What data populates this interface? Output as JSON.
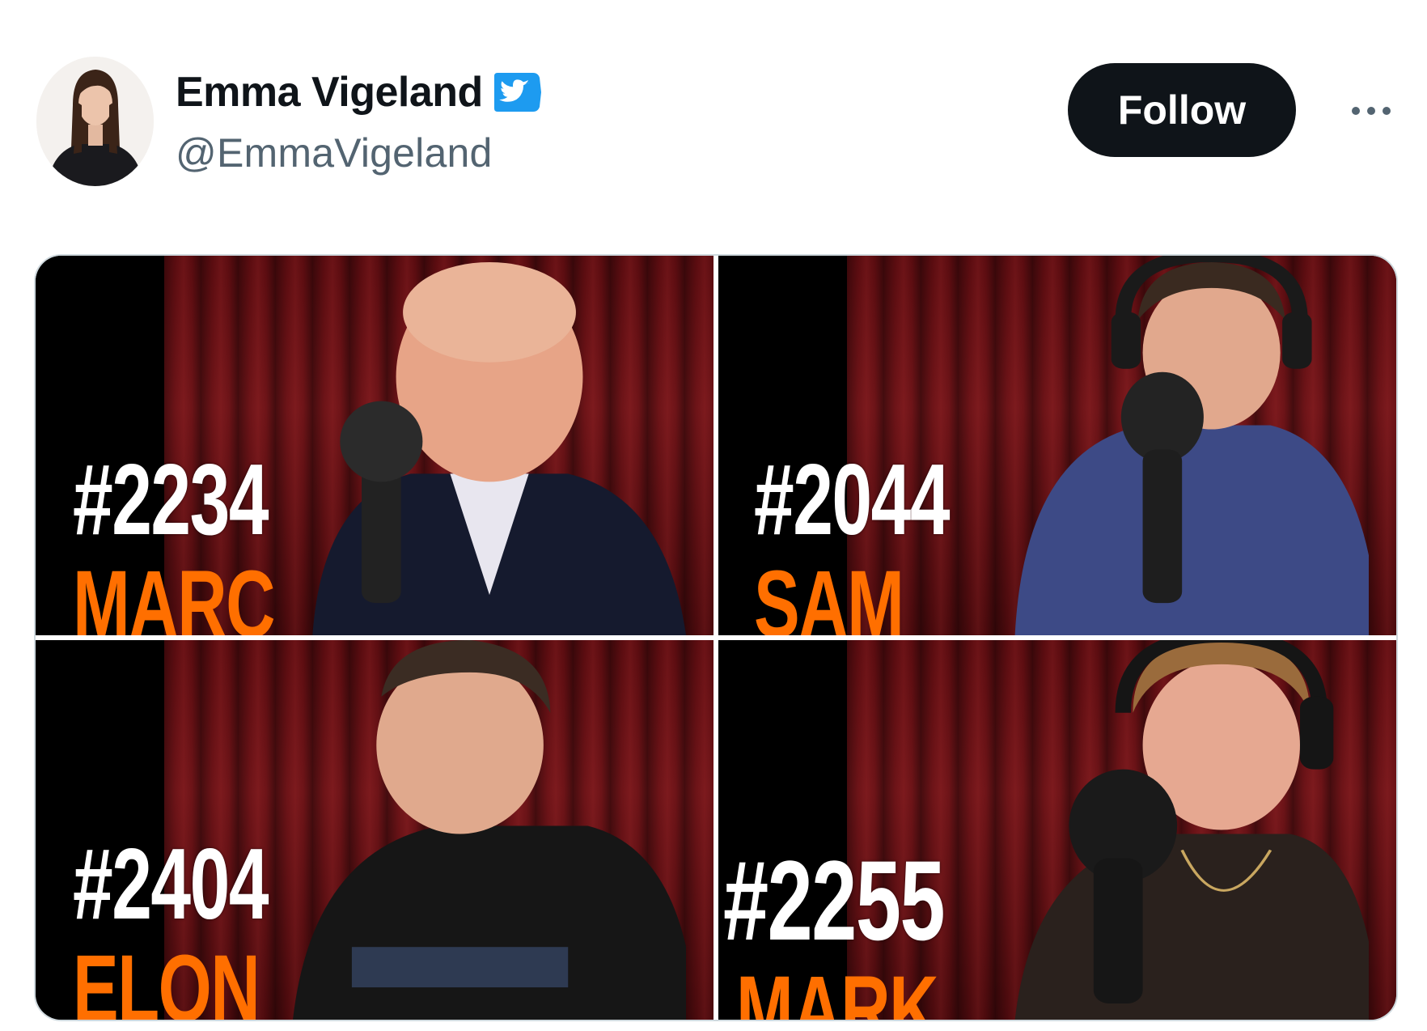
{
  "author": {
    "display_name": "Emma Vigeland",
    "handle": "@EmmaVigeland",
    "verified": true,
    "avatar_icon": "profile-photo"
  },
  "actions": {
    "follow_label": "Follow",
    "more_icon": "more-horizontal-icon"
  },
  "colors": {
    "follow_bg": "#0f1419",
    "verified_blue": "#1d9bf0",
    "handle_gray": "#536471",
    "name_orange": "#ff6f00",
    "curtain_red": "#6e1418"
  },
  "media": {
    "tiles": [
      {
        "episode": "#2234",
        "name": "MARC"
      },
      {
        "episode": "#2044",
        "name": "SAM"
      },
      {
        "episode": "#2404",
        "name": "ELON"
      },
      {
        "episode": "#2255",
        "name": "MARK"
      }
    ]
  }
}
